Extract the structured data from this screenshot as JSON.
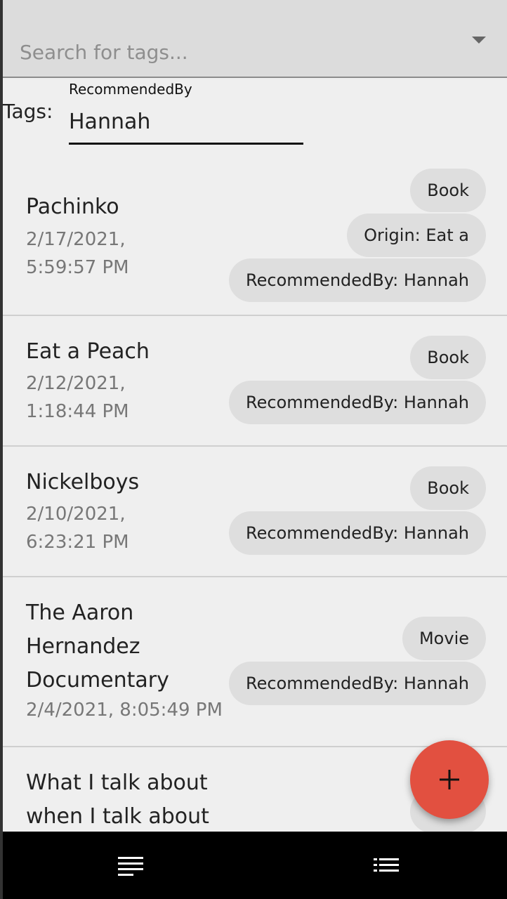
{
  "search": {
    "placeholder": "Search for tags..."
  },
  "tags": {
    "label": "Tags:",
    "field_label": "RecommendedBy",
    "field_value": "Hannah"
  },
  "items": [
    {
      "title": "Pachinko",
      "date_line1": "2/17/2021,",
      "date_line2": "5:59:57 PM",
      "chips": [
        "Book",
        "Origin: Eat a",
        "RecommendedBy: Hannah"
      ]
    },
    {
      "title": "Eat a Peach",
      "date_line1": "2/12/2021,",
      "date_line2": "1:18:44 PM",
      "chips": [
        "Book",
        "RecommendedBy: Hannah"
      ]
    },
    {
      "title": "Nickelboys",
      "date_line1": "2/10/2021,",
      "date_line2": "6:23:21 PM",
      "chips": [
        "Book",
        "RecommendedBy: Hannah"
      ]
    },
    {
      "title_line1": "The Aaron",
      "title_line2": "Hernandez",
      "title_line3": "Documentary",
      "date": "2/4/2021, 8:05:49 PM",
      "chips": [
        "Movie",
        "RecommendedBy: Hannah"
      ]
    },
    {
      "title_line1": "What I talk about",
      "title_line2": "when I talk about"
    }
  ],
  "fab": {
    "icon": "plus-icon"
  },
  "bottom_nav": {
    "left_icon": "menu-icon",
    "right_icon": "list-icon"
  },
  "colors": {
    "fab": "#e25040",
    "chip": "#dedede",
    "background": "#efefef"
  }
}
